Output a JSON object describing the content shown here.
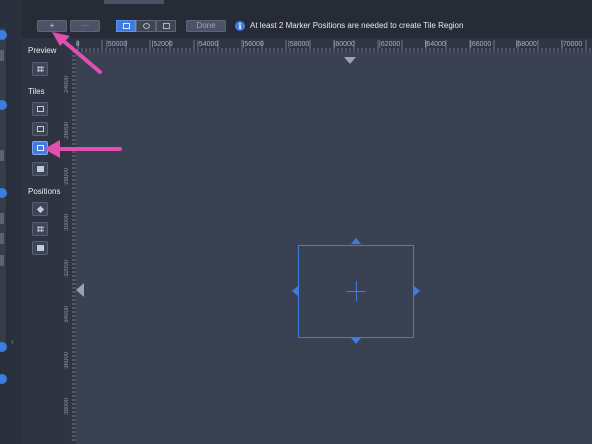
{
  "toolbar": {
    "add_button_label": "+",
    "remove_button_label": "—",
    "done_button_label": "Done",
    "info_icon_glyph": "i",
    "info_message": "At least 2 Marker Positions are needed to create Tile Region"
  },
  "tool_panel": {
    "groups": [
      {
        "label": "Preview"
      },
      {
        "label": "Tiles"
      },
      {
        "label": "Positions"
      }
    ]
  },
  "ruler": {
    "top_labels": [
      "|48",
      "|50000",
      "|52000",
      "|54000",
      "|56000",
      "|58000",
      "|60000",
      "|62000",
      "|64000",
      "|66000",
      "|68000",
      "|70000"
    ],
    "left_labels": [
      "24000",
      "26000",
      "28000",
      "30000",
      "32000",
      "34000",
      "36000",
      "38000"
    ]
  },
  "colors": {
    "accent": "#3f7be0",
    "annotation": "#e24fb0",
    "canvas": "#3a4152"
  },
  "icons": {
    "info": "info-icon",
    "rectangle_select": "rectangle-icon",
    "circle_select": "circle-icon",
    "tile_region": "tile-region-icon",
    "position_marker": "diamond-icon"
  }
}
